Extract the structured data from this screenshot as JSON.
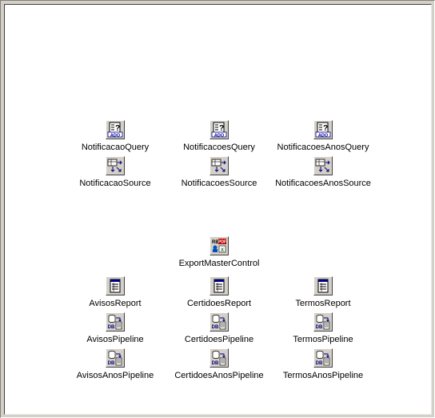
{
  "components": {
    "notificacao_query": {
      "name": "NotificacaoQuery",
      "icon": "ado-query-icon"
    },
    "notificacoes_query": {
      "name": "NotificacoesQuery",
      "icon": "ado-query-icon"
    },
    "notificacoes_anos_query": {
      "name": "NotificacoesAnosQuery",
      "icon": "ado-query-icon"
    },
    "notificacao_source": {
      "name": "NotificacaoSource",
      "icon": "data-source-icon"
    },
    "notificacoes_source": {
      "name": "NotificacoesSource",
      "icon": "data-source-icon"
    },
    "notificacoes_anos_source": {
      "name": "NotificacoesAnosSource",
      "icon": "data-source-icon"
    },
    "export_master_control": {
      "name": "ExportMasterControl",
      "icon": "rb-pdf-export-icon"
    },
    "avisos_report": {
      "name": "AvisosReport",
      "icon": "report-icon"
    },
    "certidoes_report": {
      "name": "CertidoesReport",
      "icon": "report-icon"
    },
    "termos_report": {
      "name": "TermosReport",
      "icon": "report-icon"
    },
    "avisos_pipeline": {
      "name": "AvisosPipeline",
      "icon": "db-pipeline-icon"
    },
    "certidoes_pipeline": {
      "name": "CertidoesPipeline",
      "icon": "db-pipeline-icon"
    },
    "termos_pipeline": {
      "name": "TermosPipeline",
      "icon": "db-pipeline-icon"
    },
    "avisos_anos_pipeline": {
      "name": "AvisosAnosPipeline",
      "icon": "db-pipeline-icon"
    },
    "certidoes_anos_pipeline": {
      "name": "CertidoesAnosPipeline",
      "icon": "db-pipeline-icon"
    },
    "termos_anos_pipeline": {
      "name": "TermosAnosPipeline",
      "icon": "db-pipeline-icon"
    }
  },
  "colors": {
    "canvas": "#ffffff",
    "icon_face": "#d4d0c8",
    "ado_text": "#0000a0",
    "pdf_red": "#c00000"
  }
}
